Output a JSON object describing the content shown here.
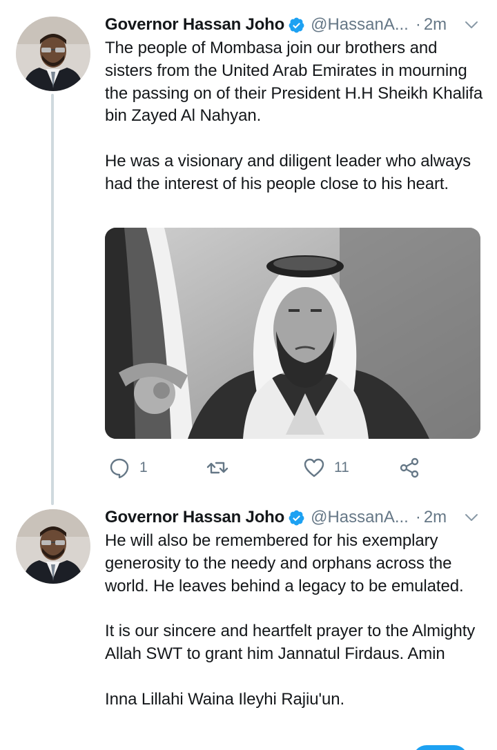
{
  "colors": {
    "brand_blue": "#1da1f2",
    "secondary_text": "#657786",
    "thread_line": "#cfd9de",
    "primary_text": "#14171a"
  },
  "tweets": [
    {
      "author_name": "Governor Hassan Joho",
      "handle": "@HassanA...",
      "separator": "·",
      "time": "2m",
      "verified_icon": "verified-badge-icon",
      "paragraphs": [
        "The people of Mombasa join our brothers and sisters from the United Arab Emirates in mourning the passing on of their President H.H Sheikh Khalifa bin Zayed Al Nahyan.",
        "He was a visionary and diligent leader who always had the interest of his people close to his heart."
      ],
      "has_media": true,
      "actions": {
        "reply_count": "1",
        "retweet_count": "",
        "like_count": "11"
      }
    },
    {
      "author_name": "Governor Hassan Joho",
      "handle": "@HassanA...",
      "separator": "·",
      "time": "2m",
      "verified_icon": "verified-badge-icon",
      "paragraphs": [
        "He will also be remembered for his exemplary generosity to the needy and orphans across the world. He leaves behind a legacy to be emulated.",
        "It is our sincere and heartfelt prayer to the Almighty Allah SWT to grant him Jannatul Firdaus. Amin",
        "Inna Lillahi Waina Ileyhi Rajiu'un."
      ]
    }
  ],
  "icons": {
    "reply": "reply-icon",
    "retweet": "retweet-icon",
    "like": "heart-icon",
    "share": "share-icon",
    "more": "chevron-down-icon"
  }
}
